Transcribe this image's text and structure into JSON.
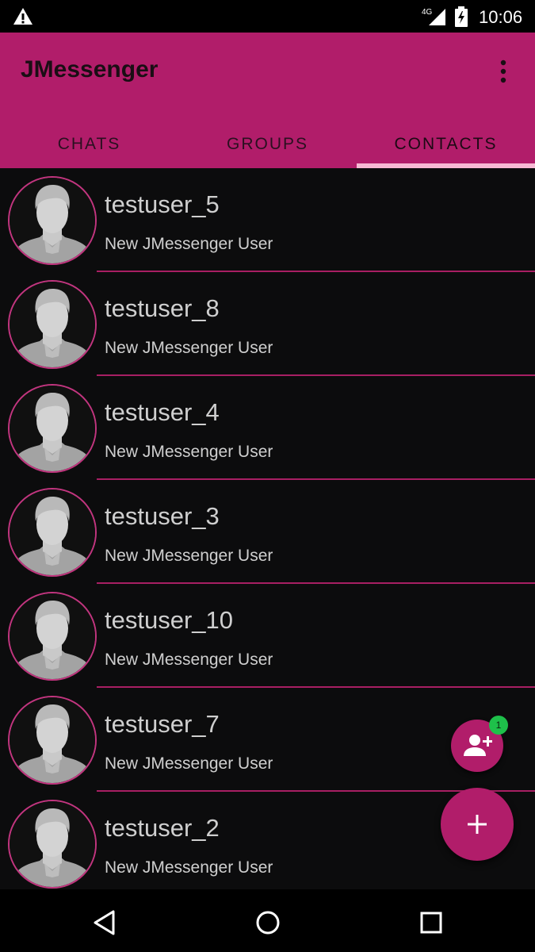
{
  "status_bar": {
    "time": "10:06",
    "network": "4G",
    "icons": [
      "warning-icon",
      "signal-icon",
      "battery-charging-icon"
    ]
  },
  "app_bar": {
    "title": "JMessenger",
    "menu_icon": "more-vert-icon"
  },
  "tabs": [
    {
      "label": "CHATS",
      "active": false
    },
    {
      "label": "GROUPS",
      "active": false
    },
    {
      "label": "CONTACTS",
      "active": true
    }
  ],
  "contacts": [
    {
      "name": "testuser_5",
      "status": "New JMessenger User"
    },
    {
      "name": "testuser_8",
      "status": "New JMessenger User"
    },
    {
      "name": "testuser_4",
      "status": "New JMessenger User"
    },
    {
      "name": "testuser_3",
      "status": "New JMessenger User"
    },
    {
      "name": "testuser_10",
      "status": "New JMessenger User"
    },
    {
      "name": "testuser_7",
      "status": "New JMessenger User"
    },
    {
      "name": "testuser_2",
      "status": "New JMessenger User"
    }
  ],
  "fab_contact_requests": {
    "icon": "person-add-icon",
    "badge": "1"
  },
  "fab_new": {
    "icon": "plus-icon"
  },
  "nav_bar": {
    "icons": [
      "back-icon",
      "home-icon",
      "recents-icon"
    ]
  },
  "colors": {
    "primary": "#b11d6a",
    "accent_indicator": "#f7b9d4",
    "background": "#0c0c0d",
    "badge": "#1ec04a"
  }
}
